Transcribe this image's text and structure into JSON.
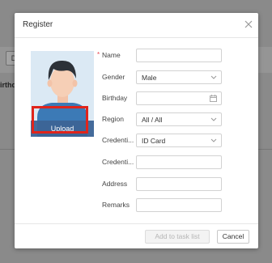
{
  "dialog": {
    "title": "Register",
    "photo": {
      "upload_label": "Upload"
    },
    "fields": [
      {
        "label": "Name",
        "required": true,
        "value": ""
      },
      {
        "label": "Gender",
        "value": "Male"
      },
      {
        "label": "Birthday",
        "value": ""
      },
      {
        "label": "Region",
        "value": "All / All"
      },
      {
        "label": "Credenti...",
        "value": "ID Card"
      },
      {
        "label": "Credenti...",
        "value": ""
      },
      {
        "label": "Address",
        "value": ""
      },
      {
        "label": "Remarks",
        "value": ""
      }
    ],
    "buttons": {
      "add_to_task_list": "Add to task list",
      "cancel": "Cancel"
    }
  },
  "background": {
    "button_label": "D",
    "column_text": "irthda"
  },
  "colors": {
    "highlight": "#e0241b",
    "required": "#e8404d"
  }
}
